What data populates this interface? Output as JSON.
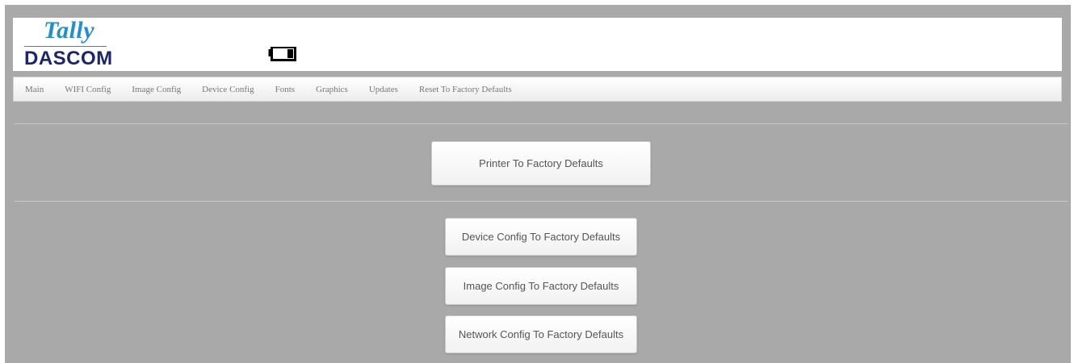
{
  "logo": {
    "tally": "Tally",
    "dascom": "DASCOM"
  },
  "header": {
    "battery_icon": "battery-icon"
  },
  "menu": {
    "items": [
      "Main",
      "WIFI Config",
      "Image Config",
      "Device Config",
      "Fonts",
      "Graphics",
      "Updates",
      "Reset To Factory Defaults"
    ]
  },
  "actions": {
    "printer_defaults": "Printer To Factory Defaults",
    "device_defaults": "Device Config To Factory Defaults",
    "image_defaults": "Image Config To Factory Defaults",
    "network_defaults": "Network Config To Factory Defaults"
  },
  "colors": {
    "page_background": "#a9a9a9",
    "logo_blue": "#1f8fd0",
    "logo_navy": "#1b2470"
  }
}
